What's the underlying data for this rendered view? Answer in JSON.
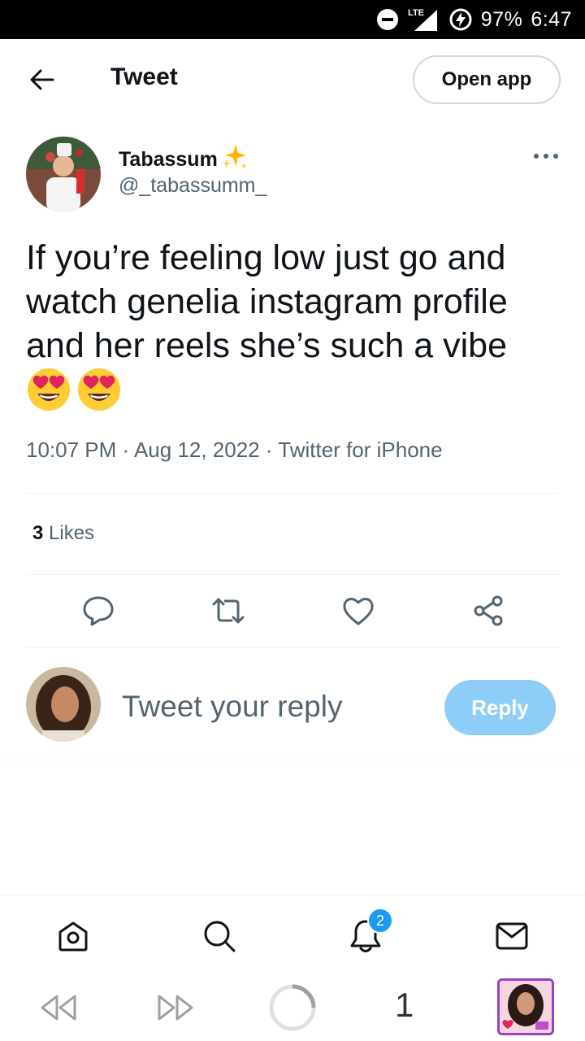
{
  "status_bar": {
    "network": "LTE",
    "battery": "97%",
    "time": "6:47"
  },
  "header": {
    "title": "Tweet",
    "open_app_label": "Open app"
  },
  "tweet": {
    "author_name": "Tabassum",
    "author_handle": "@_tabassumm_",
    "text": "If you’re feeling low just go and watch genelia instagram profile and her reels she’s such a vibe",
    "emojis": [
      "😍",
      "😍"
    ],
    "timestamp": "10:07 PM · Aug 12, 2022 · Twitter for iPhone",
    "likes_count": "3",
    "likes_label": "Likes"
  },
  "reply": {
    "placeholder": "Tweet your reply",
    "button_label": "Reply"
  },
  "bottom_nav": {
    "notifications_badge": "2"
  },
  "browser": {
    "tab_count": "1"
  },
  "colors": {
    "accent": "#1d9bf0",
    "reply_button": "#8ecdf8",
    "secondary_text": "#536471",
    "thumbnail_border": "#9b3fc6"
  }
}
